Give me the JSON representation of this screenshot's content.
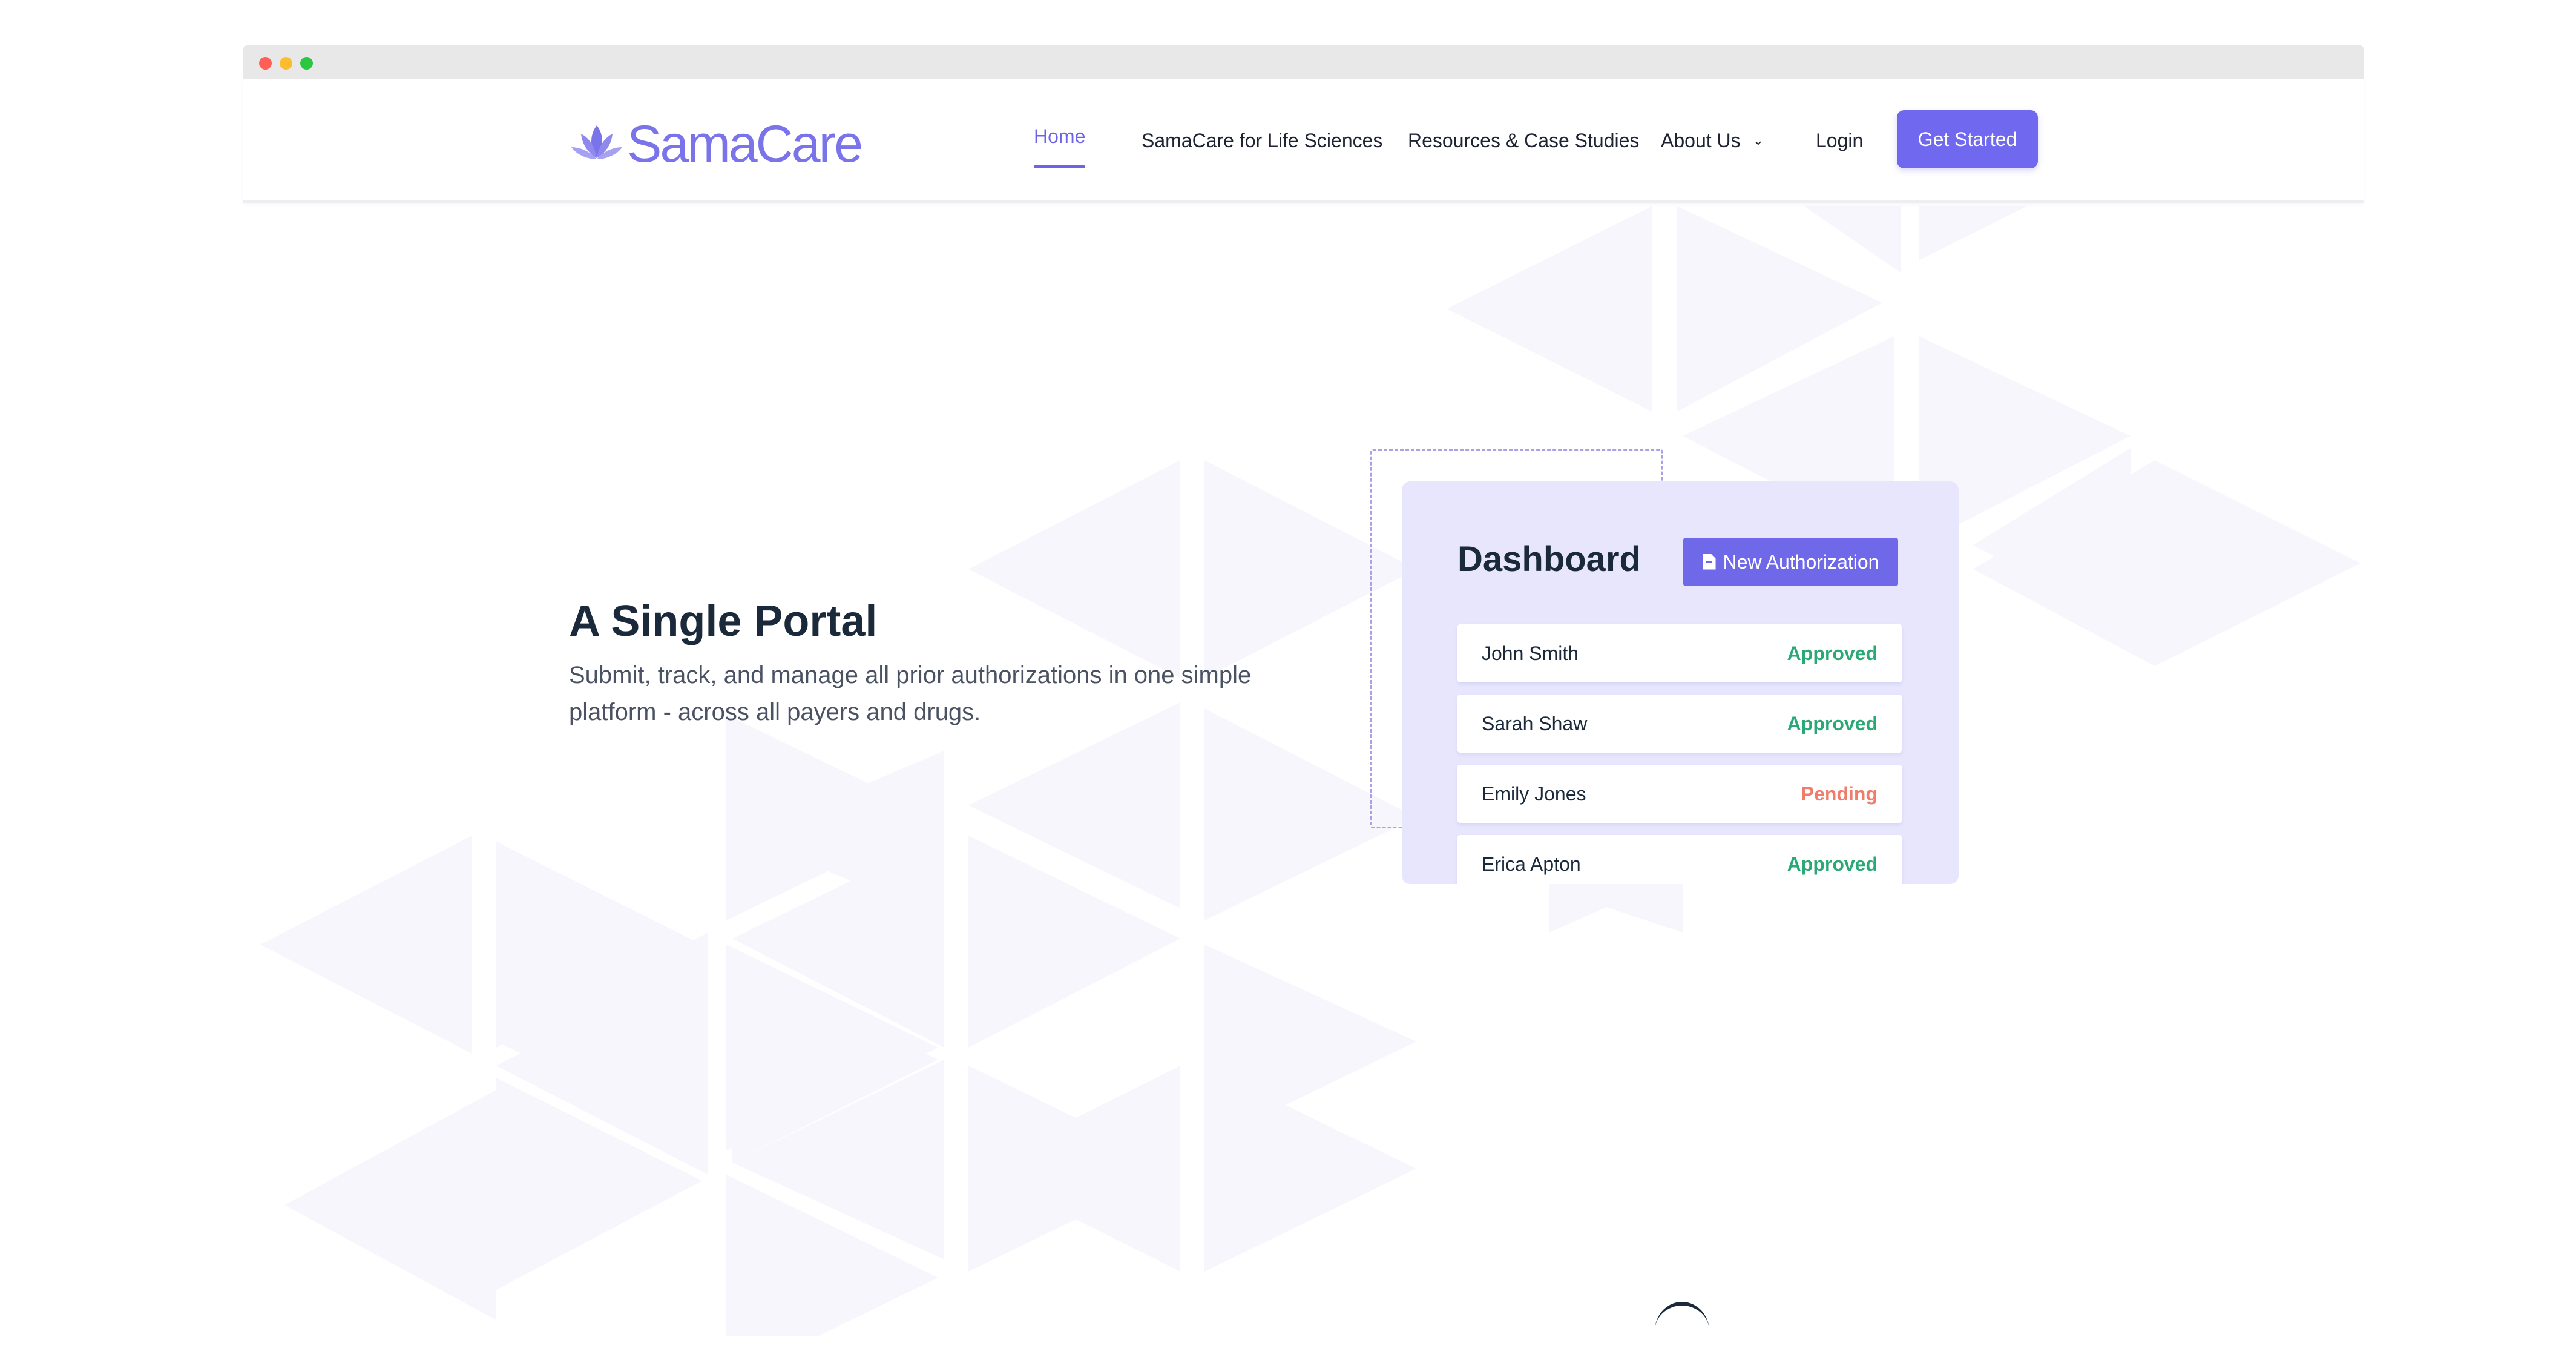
{
  "brand": {
    "name": "SamaCare",
    "color": "#7a73ea"
  },
  "nav": {
    "items": [
      {
        "label": "Home",
        "active": true
      },
      {
        "label": "SamaCare for Life Sciences",
        "active": false
      },
      {
        "label": "Resources & Case Studies",
        "active": false
      },
      {
        "label": "About Us",
        "active": false,
        "has_dropdown": true
      },
      {
        "label": "Login",
        "active": false
      }
    ],
    "cta_label": "Get Started"
  },
  "hero": {
    "title": "A Single Portal",
    "subtitle": "Submit, track, and manage all prior authorizations in one simple platform - across all payers and drugs."
  },
  "dashboard": {
    "title": "Dashboard",
    "new_button_label": "New Authorization",
    "rows": [
      {
        "name": "John Smith",
        "status": "Approved",
        "status_color": "#2aa876"
      },
      {
        "name": "Sarah Shaw",
        "status": "Approved",
        "status_color": "#2aa876"
      },
      {
        "name": "Emily Jones",
        "status": "Pending",
        "status_color": "#f07d6b"
      },
      {
        "name": "Erica Apton",
        "status": "Approved",
        "status_color": "#2aa876"
      }
    ]
  },
  "colors": {
    "accent": "#7069ef",
    "approved": "#2aa876",
    "pending": "#f07d6b",
    "heading": "#1b2a3b"
  }
}
